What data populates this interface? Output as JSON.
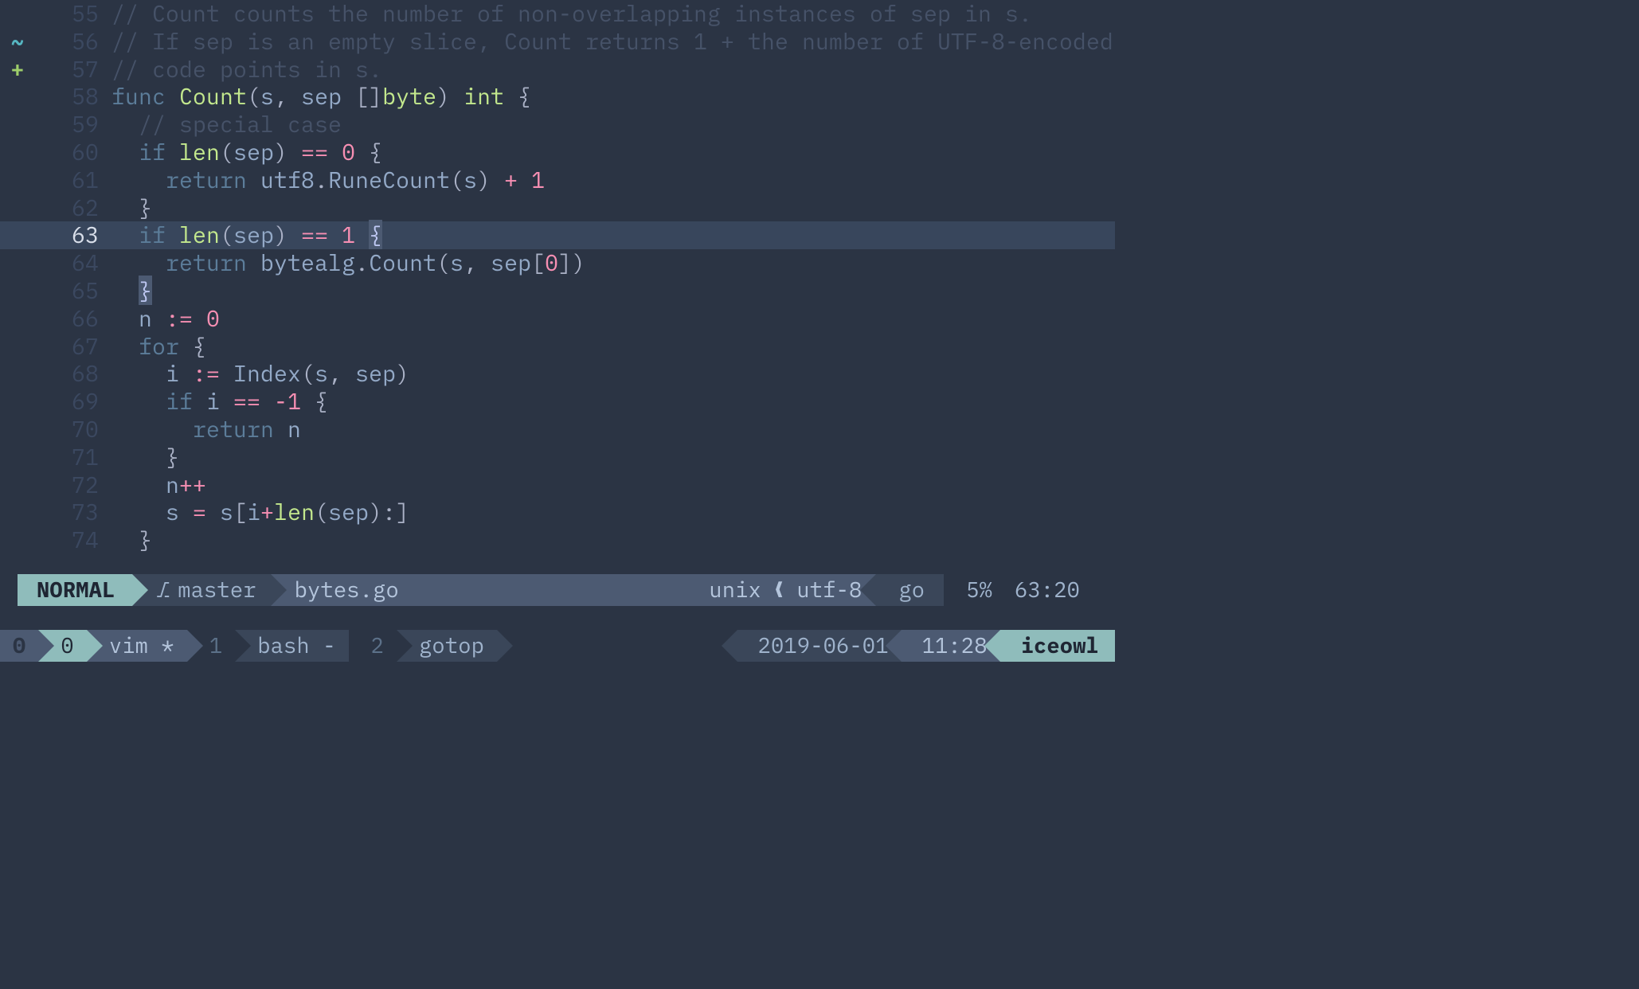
{
  "lines": [
    {
      "num": "55",
      "sign": "",
      "code": [
        {
          "cls": "c-comment",
          "txt": "// Count counts the number of non-overlapping instances of sep in s."
        }
      ]
    },
    {
      "num": "56",
      "sign": "~",
      "sign_cls": "tilde",
      "code": [
        {
          "cls": "c-comment",
          "txt": "// If sep is an empty slice, Count returns 1 + the number of UTF-8-encoded"
        }
      ]
    },
    {
      "num": "57",
      "sign": "+",
      "sign_cls": "plus",
      "code": [
        {
          "cls": "c-comment",
          "txt": "// code points in s."
        }
      ]
    },
    {
      "num": "58",
      "sign": "",
      "code": [
        {
          "cls": "c-keyword",
          "txt": "func "
        },
        {
          "cls": "c-func",
          "txt": "Count"
        },
        {
          "cls": "c-paren",
          "txt": "("
        },
        {
          "cls": "c-ident",
          "txt": "s"
        },
        {
          "cls": "c-paren",
          "txt": ", "
        },
        {
          "cls": "c-ident",
          "txt": "sep "
        },
        {
          "cls": "c-paren",
          "txt": "[]"
        },
        {
          "cls": "c-type",
          "txt": "byte"
        },
        {
          "cls": "c-paren",
          "txt": ") "
        },
        {
          "cls": "c-type",
          "txt": "int "
        },
        {
          "cls": "c-brace",
          "txt": "{"
        }
      ]
    },
    {
      "num": "59",
      "sign": "",
      "code": [
        {
          "cls": "c-plain",
          "txt": "  "
        },
        {
          "cls": "c-comment",
          "txt": "// special case"
        }
      ]
    },
    {
      "num": "60",
      "sign": "",
      "code": [
        {
          "cls": "c-plain",
          "txt": "  "
        },
        {
          "cls": "c-keyword",
          "txt": "if "
        },
        {
          "cls": "c-func",
          "txt": "len"
        },
        {
          "cls": "c-paren",
          "txt": "("
        },
        {
          "cls": "c-ident",
          "txt": "sep"
        },
        {
          "cls": "c-paren",
          "txt": ") "
        },
        {
          "cls": "c-op",
          "txt": "== "
        },
        {
          "cls": "c-num",
          "txt": "0 "
        },
        {
          "cls": "c-brace",
          "txt": "{"
        }
      ]
    },
    {
      "num": "61",
      "sign": "",
      "code": [
        {
          "cls": "c-plain",
          "txt": "    "
        },
        {
          "cls": "c-keyword",
          "txt": "return "
        },
        {
          "cls": "c-ident",
          "txt": "utf8"
        },
        {
          "cls": "c-plain",
          "txt": "."
        },
        {
          "cls": "c-ident",
          "txt": "RuneCount"
        },
        {
          "cls": "c-paren",
          "txt": "("
        },
        {
          "cls": "c-ident",
          "txt": "s"
        },
        {
          "cls": "c-paren",
          "txt": ") "
        },
        {
          "cls": "c-op",
          "txt": "+ "
        },
        {
          "cls": "c-num",
          "txt": "1"
        }
      ]
    },
    {
      "num": "62",
      "sign": "",
      "code": [
        {
          "cls": "c-plain",
          "txt": "  "
        },
        {
          "cls": "c-brace",
          "txt": "}"
        }
      ]
    },
    {
      "num": "63",
      "sign": "",
      "current": true,
      "code": [
        {
          "cls": "c-plain",
          "txt": "  "
        },
        {
          "cls": "c-keyword",
          "txt": "if "
        },
        {
          "cls": "c-func",
          "txt": "len"
        },
        {
          "cls": "c-paren",
          "txt": "("
        },
        {
          "cls": "c-ident",
          "txt": "sep"
        },
        {
          "cls": "c-paren",
          "txt": ") "
        },
        {
          "cls": "c-op",
          "txt": "== "
        },
        {
          "cls": "c-num",
          "txt": "1 "
        },
        {
          "cls": "c-cursor",
          "txt": "{"
        }
      ]
    },
    {
      "num": "64",
      "sign": "",
      "code": [
        {
          "cls": "c-plain",
          "txt": "    "
        },
        {
          "cls": "c-keyword",
          "txt": "return "
        },
        {
          "cls": "c-ident",
          "txt": "bytealg"
        },
        {
          "cls": "c-plain",
          "txt": "."
        },
        {
          "cls": "c-ident",
          "txt": "Count"
        },
        {
          "cls": "c-paren",
          "txt": "("
        },
        {
          "cls": "c-ident",
          "txt": "s"
        },
        {
          "cls": "c-plain",
          "txt": ", "
        },
        {
          "cls": "c-ident",
          "txt": "sep"
        },
        {
          "cls": "c-paren",
          "txt": "["
        },
        {
          "cls": "c-num",
          "txt": "0"
        },
        {
          "cls": "c-paren",
          "txt": "])"
        }
      ]
    },
    {
      "num": "65",
      "sign": "",
      "code": [
        {
          "cls": "c-plain",
          "txt": "  "
        },
        {
          "cls": "c-match",
          "txt": "}"
        }
      ]
    },
    {
      "num": "66",
      "sign": "",
      "code": [
        {
          "cls": "c-plain",
          "txt": "  "
        },
        {
          "cls": "c-ident",
          "txt": "n "
        },
        {
          "cls": "c-op",
          "txt": ":= "
        },
        {
          "cls": "c-num",
          "txt": "0"
        }
      ]
    },
    {
      "num": "67",
      "sign": "",
      "code": [
        {
          "cls": "c-plain",
          "txt": "  "
        },
        {
          "cls": "c-keyword",
          "txt": "for "
        },
        {
          "cls": "c-brace",
          "txt": "{"
        }
      ]
    },
    {
      "num": "68",
      "sign": "",
      "code": [
        {
          "cls": "c-plain",
          "txt": "    "
        },
        {
          "cls": "c-ident",
          "txt": "i "
        },
        {
          "cls": "c-op",
          "txt": ":= "
        },
        {
          "cls": "c-ident",
          "txt": "Index"
        },
        {
          "cls": "c-paren",
          "txt": "("
        },
        {
          "cls": "c-ident",
          "txt": "s"
        },
        {
          "cls": "c-plain",
          "txt": ", "
        },
        {
          "cls": "c-ident",
          "txt": "sep"
        },
        {
          "cls": "c-paren",
          "txt": ")"
        }
      ]
    },
    {
      "num": "69",
      "sign": "",
      "code": [
        {
          "cls": "c-plain",
          "txt": "    "
        },
        {
          "cls": "c-keyword",
          "txt": "if "
        },
        {
          "cls": "c-ident",
          "txt": "i "
        },
        {
          "cls": "c-op",
          "txt": "== -"
        },
        {
          "cls": "c-num",
          "txt": "1 "
        },
        {
          "cls": "c-brace",
          "txt": "{"
        }
      ]
    },
    {
      "num": "70",
      "sign": "",
      "code": [
        {
          "cls": "c-plain",
          "txt": "      "
        },
        {
          "cls": "c-keyword",
          "txt": "return "
        },
        {
          "cls": "c-ident",
          "txt": "n"
        }
      ]
    },
    {
      "num": "71",
      "sign": "",
      "code": [
        {
          "cls": "c-plain",
          "txt": "    "
        },
        {
          "cls": "c-brace",
          "txt": "}"
        }
      ]
    },
    {
      "num": "72",
      "sign": "",
      "code": [
        {
          "cls": "c-plain",
          "txt": "    "
        },
        {
          "cls": "c-ident",
          "txt": "n"
        },
        {
          "cls": "c-op",
          "txt": "++"
        }
      ]
    },
    {
      "num": "73",
      "sign": "",
      "code": [
        {
          "cls": "c-plain",
          "txt": "    "
        },
        {
          "cls": "c-ident",
          "txt": "s "
        },
        {
          "cls": "c-op",
          "txt": "= "
        },
        {
          "cls": "c-ident",
          "txt": "s"
        },
        {
          "cls": "c-paren",
          "txt": "["
        },
        {
          "cls": "c-ident",
          "txt": "i"
        },
        {
          "cls": "c-op",
          "txt": "+"
        },
        {
          "cls": "c-func",
          "txt": "len"
        },
        {
          "cls": "c-paren",
          "txt": "("
        },
        {
          "cls": "c-ident",
          "txt": "sep"
        },
        {
          "cls": "c-paren",
          "txt": "):]"
        }
      ]
    },
    {
      "num": "74",
      "sign": "",
      "code": [
        {
          "cls": "c-plain",
          "txt": "  "
        },
        {
          "cls": "c-brace",
          "txt": "}"
        }
      ]
    }
  ],
  "statusline": {
    "mode": "NORMAL",
    "branch_icon": "⎇",
    "branch": " master",
    "filename": "bytes.go",
    "fileformat": "unix",
    "encoding": "utf-8",
    "filetype": "go",
    "percent": "5%",
    "position": "63:20"
  },
  "tmux": {
    "session": "0",
    "windows": [
      {
        "index": "0",
        "name": "vim *",
        "active": true
      },
      {
        "index": "1",
        "name": "bash -",
        "active": false
      },
      {
        "index": "2",
        "name": "gotop",
        "active": false
      }
    ],
    "date": "2019-06-01",
    "time": "11:28",
    "host": "iceowl"
  }
}
